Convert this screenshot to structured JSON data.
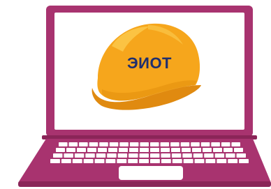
{
  "illustration": {
    "helmet_label": "ЭИОТ"
  },
  "colors": {
    "laptop_frame": "#a8336f",
    "laptop_frame_dark": "#8a2558",
    "screen": "#ffffff",
    "helmet_main": "#f6a61c",
    "helmet_light": "#fbc84a",
    "helmet_shadow": "#e08a10",
    "label": "#1f2f6e",
    "keys": "#ffffff",
    "touchpad": "#ffffff"
  },
  "icons": {
    "laptop": "laptop-icon",
    "helmet": "hard-hat-icon"
  }
}
